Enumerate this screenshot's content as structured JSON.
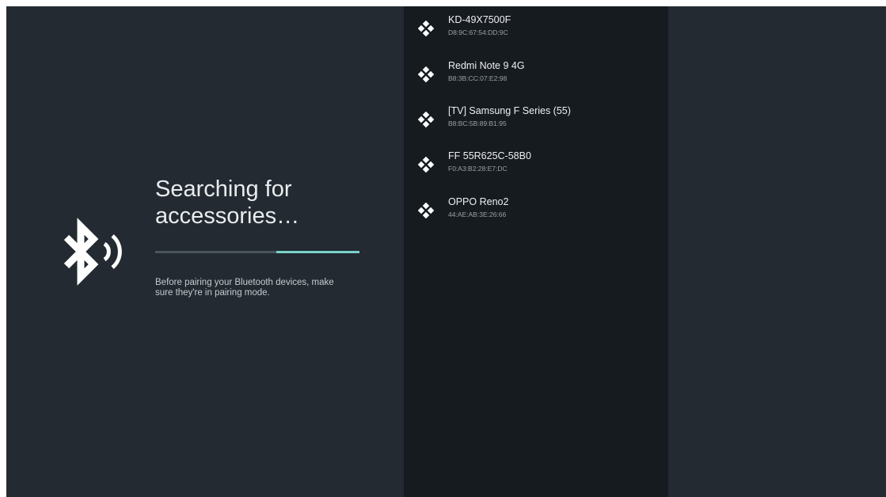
{
  "pairing": {
    "title_line1": "Searching for",
    "title_line2": "accessories…",
    "hint_line1": "Before pairing your Bluetooth devices, make",
    "hint_line2": "sure they're in pairing mode.",
    "progress_icon": "bluetooth-searching-icon"
  },
  "devices": [
    {
      "name": "KD-49X7500F",
      "mac": "D8:9C:67:54:DD:9C",
      "icon": "gamepad-icon"
    },
    {
      "name": "Redmi Note 9 4G",
      "mac": "B8:3B:CC:07:E2:98",
      "icon": "gamepad-icon"
    },
    {
      "name": "[TV] Samsung F Series (55)",
      "mac": "B8:BC:5B:89:B1:95",
      "icon": "gamepad-icon"
    },
    {
      "name": "FF 55R625C-58B0",
      "mac": "F0:A3:B2:28:E7:DC",
      "icon": "gamepad-icon"
    },
    {
      "name": "OPPO Reno2",
      "mac": "44:AE:AB:3E:26:66",
      "icon": "gamepad-icon"
    }
  ],
  "colors": {
    "background": "#232a31",
    "device_panel": "#161b1f",
    "accent": "#79d2c9"
  }
}
